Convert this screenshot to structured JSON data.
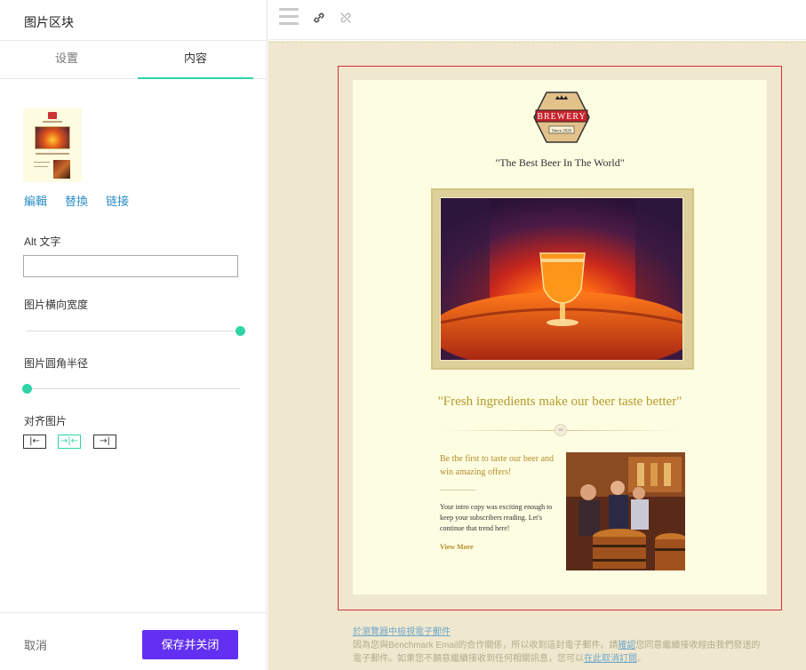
{
  "panel": {
    "title": "图片区块",
    "tabs": [
      "设置",
      "内容"
    ],
    "active_tab": "内容",
    "image_actions": [
      "編輯",
      "替換",
      "链接"
    ],
    "alt_label": "Alt 文字",
    "alt_value": "",
    "width_label": "图片横向宽度",
    "width_value": 1.0,
    "radius_label": "图片圆角半径",
    "radius_value": 0.0,
    "align_label": "对齐图片",
    "align_options": [
      "left-align-icon",
      "center-align-icon",
      "right-align-icon"
    ],
    "align_selected": "center",
    "cancel_label": "取消",
    "save_label": "保存并关闭"
  },
  "toolbar": {
    "icons": [
      "menu-icon",
      "link-icon",
      "unlink-icon"
    ]
  },
  "email": {
    "logo": {
      "name": "BREWERY",
      "since": "Since 2020"
    },
    "tagline": "\"The Best Beer In The World\"",
    "quote": "\"Fresh ingredients make our beer taste better\"",
    "promo_title": "Be the first to taste our beer and win amazing offers!",
    "promo_copy": "Your intro copy was exciting enough to keep your subscribers reading. Let's continue that trend here!",
    "view_more": "View More"
  },
  "legal": {
    "view_in_browser": "於瀏覽器中檢視電子郵件",
    "line1_prefix": "因為您與Benchmark Email的合作關係，所以收到這封電子郵件。請",
    "confirm_link": "確認",
    "line1_suffix": "您同意繼續接收經由我們發送的",
    "line2_prefix": "電子郵件。如果您不願意繼續接收到任何相關訊息，您可以",
    "unsubscribe_link": "在此取消訂閱",
    "line2_suffix": "。"
  },
  "colors": {
    "accent": "#2fd4a6",
    "primary_button": "#6330f2",
    "selection_border": "#d42c3c",
    "canvas_bg": "#efe8cf",
    "email_bg": "#fdfde2",
    "link": "#2c8fc9"
  }
}
